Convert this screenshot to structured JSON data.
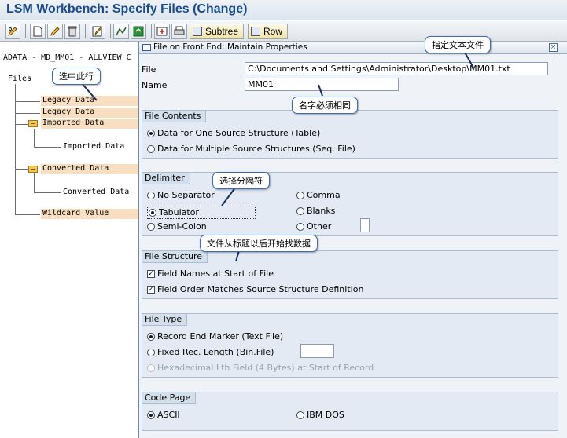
{
  "window": {
    "title": "LSM Workbench: Specify Files (Change)"
  },
  "toolbar": {
    "subtree_label": "Subtree",
    "row_label": "Row"
  },
  "tree": {
    "header": "ADATA - MD_MM01 - ALLVIEW C",
    "files_label": "Files",
    "legacy_data_1": "Legacy Data",
    "legacy_data_2": "Legacy Data",
    "imported_data_folder": "Imported Data",
    "imported_data_item": "Imported Data",
    "converted_data_folder": "Converted Data",
    "converted_data_item": "Converted Data",
    "wildcard_value": "Wildcard Value"
  },
  "dialog": {
    "title": "File on Front End: Maintain Properties",
    "file_label": "File",
    "file_value": "C:\\Documents and Settings\\Administrator\\Desktop\\MM01.txt",
    "name_label": "Name",
    "name_value": "MM01",
    "file_contents": {
      "title": "File Contents",
      "option_table": "Data for One Source Structure (Table)",
      "option_seq": "Data for Multiple Source Structures (Seq. File)"
    },
    "delimiter": {
      "title": "Delimiter",
      "no_separator": "No Separator",
      "tabulator": "Tabulator",
      "semi_colon": "Semi-Colon",
      "comma": "Comma",
      "blanks": "Blanks",
      "other": "Other"
    },
    "file_structure": {
      "title": "File Structure",
      "field_names": "Field Names at Start of File",
      "field_order": "Field Order Matches Source Structure Definition"
    },
    "file_type": {
      "title": "File Type",
      "record_end": "Record End Marker (Text File)",
      "fixed_length": "Fixed Rec. Length (Bin.File)",
      "hex_length": "Hexadecimal Lth Field (4 Bytes) at Start of Record"
    },
    "code_page": {
      "title": "Code Page",
      "ascii": "ASCII",
      "ibm_dos": "IBM DOS"
    }
  },
  "annotations": {
    "select_row": "选中此行",
    "specify_text_file": "指定文本文件",
    "name_must_match": "名字必须相同",
    "choose_separator": "选择分隔符",
    "find_after_header": "文件从标题以后开始找数据"
  },
  "colors": {
    "title_blue": "#1a4a8c",
    "tree_highlight": "#f9dfc2",
    "callout_border": "#3b6bb0",
    "dialog_bg": "#eff3f8"
  }
}
